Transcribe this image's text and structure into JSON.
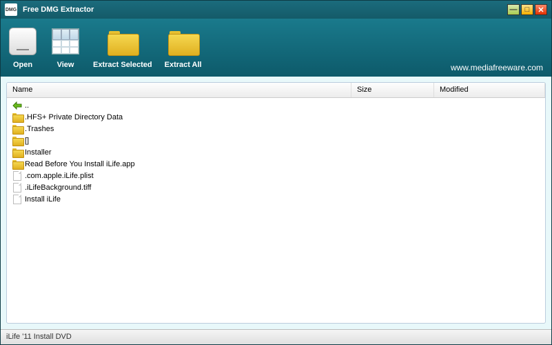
{
  "title": "Free DMG Extractor",
  "app_icon_text": "DMG",
  "toolbar": {
    "open": "Open",
    "view": "View",
    "extract_selected": "Extract Selected",
    "extract_all": "Extract All"
  },
  "url": "www.mediafreeware.com",
  "columns": {
    "name": "Name",
    "size": "Size",
    "modified": "Modified"
  },
  "rows": [
    {
      "icon": "back",
      "label": ".."
    },
    {
      "icon": "folder",
      "label": ".HFS+ Private Directory Data"
    },
    {
      "icon": "folder",
      "label": ".Trashes"
    },
    {
      "icon": "folder",
      "label": "[]"
    },
    {
      "icon": "folder",
      "label": "Installer"
    },
    {
      "icon": "folder",
      "label": "Read Before You Install iLife.app"
    },
    {
      "icon": "file",
      "label": ".com.apple.iLife.plist"
    },
    {
      "icon": "file",
      "label": ".iLifeBackground.tiff"
    },
    {
      "icon": "file",
      "label": "Install iLife"
    }
  ],
  "status": "iLife '11 Install DVD"
}
